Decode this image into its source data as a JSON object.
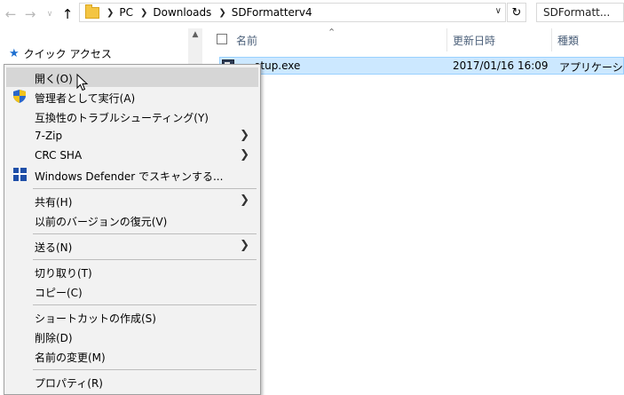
{
  "address": {
    "crumbs": [
      "PC",
      "Downloads",
      "SDFormatterv4"
    ],
    "search_placeholder": "SDFormatt..."
  },
  "navpane": {
    "quick_access": "クイック アクセス"
  },
  "columns": {
    "name": "名前",
    "date": "更新日時",
    "type": "種類"
  },
  "files": [
    {
      "name": "etup.exe",
      "date": "2017/01/16 16:09",
      "type": "アプリケーション"
    }
  ],
  "menu": {
    "items": [
      {
        "label": "開く(O)",
        "icon": "none",
        "submenu": false
      },
      {
        "label": "管理者として実行(A)",
        "icon": "uac-shield-icon",
        "submenu": false
      },
      {
        "label": "互換性のトラブルシューティング(Y)",
        "icon": "none",
        "submenu": false
      },
      {
        "label": "7-Zip",
        "icon": "none",
        "submenu": true
      },
      {
        "label": "CRC SHA",
        "icon": "none",
        "submenu": true
      },
      {
        "label": "Windows Defender でスキャンする...",
        "icon": "windows-defender-icon",
        "submenu": false
      },
      {
        "label": "共有(H)",
        "icon": "none",
        "submenu": true
      },
      {
        "label": "以前のバージョンの復元(V)",
        "icon": "none",
        "submenu": false
      },
      {
        "label": "送る(N)",
        "icon": "none",
        "submenu": true
      },
      {
        "label": "切り取り(T)",
        "icon": "none",
        "submenu": false
      },
      {
        "label": "コピー(C)",
        "icon": "none",
        "submenu": false
      },
      {
        "label": "ショートカットの作成(S)",
        "icon": "none",
        "submenu": false
      },
      {
        "label": "削除(D)",
        "icon": "none",
        "submenu": false
      },
      {
        "label": "名前の変更(M)",
        "icon": "none",
        "submenu": false
      },
      {
        "label": "プロパティ(R)",
        "icon": "none",
        "submenu": false
      }
    ]
  },
  "colors": {
    "selection": "#cce8ff",
    "menu_bg": "#f2f2f2",
    "menu_hover": "#d6d6d6",
    "header_text": "#4c607a"
  }
}
